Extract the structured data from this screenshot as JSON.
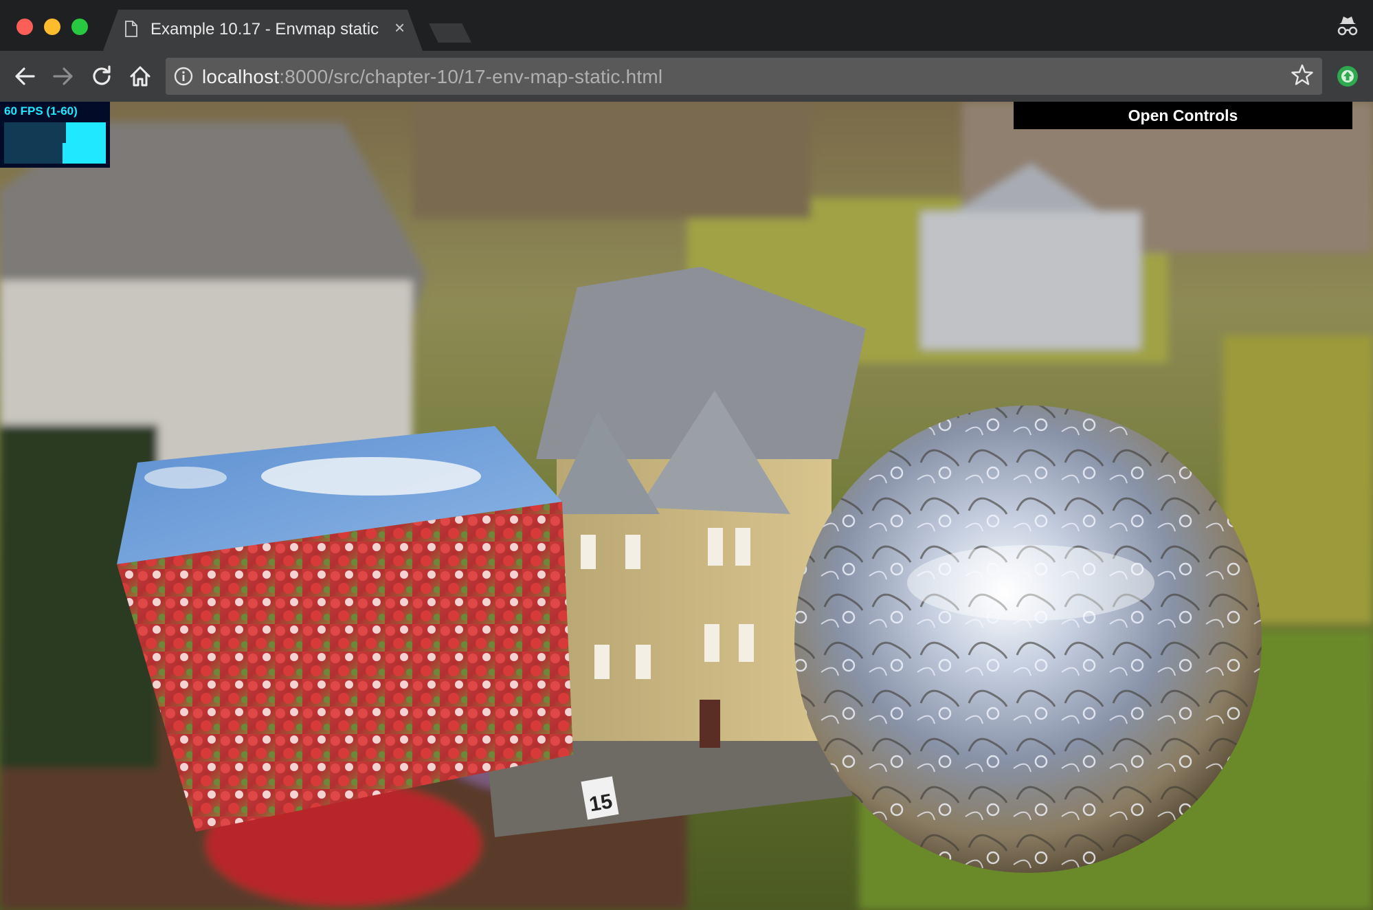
{
  "window": {
    "tab_title": "Example 10.17 - Envmap static",
    "tab_close_glyph": "×",
    "icons": [
      "window-close-icon",
      "window-minimize-icon",
      "window-maximize-icon",
      "page-icon",
      "incognito-icon"
    ]
  },
  "toolbar": {
    "url_host": "localhost",
    "url_rest": ":8000/src/chapter-10/17-env-map-static.html",
    "icons": [
      "back-arrow-icon",
      "forward-arrow-icon",
      "reload-icon",
      "home-icon",
      "info-icon",
      "star-icon",
      "extension-icon"
    ]
  },
  "page": {
    "stats_label": "60 FPS (1-60)",
    "stats_fps_history": [
      0,
      0,
      0,
      0,
      0,
      0,
      0,
      0,
      0,
      0,
      0,
      0,
      0,
      0,
      0,
      0,
      0,
      0,
      0,
      0,
      0,
      0,
      0,
      0,
      0,
      0,
      0,
      0,
      0,
      0,
      0,
      0,
      0,
      0,
      0,
      0,
      0,
      0,
      0,
      0,
      0,
      0,
      0,
      0,
      0,
      0,
      0,
      0,
      0,
      0,
      0,
      0,
      0,
      0,
      0,
      0,
      0,
      0,
      0,
      0,
      0,
      0,
      0,
      0,
      0,
      0,
      0,
      0,
      0,
      0,
      0,
      0,
      0,
      0,
      0,
      0,
      0,
      0,
      0,
      0,
      0,
      0,
      0,
      0,
      0,
      0,
      0,
      0,
      0,
      0,
      0.5,
      0.5,
      0.5,
      0.5,
      0.5,
      0.5,
      1,
      1,
      1,
      1,
      1,
      1,
      1,
      1,
      1,
      1,
      1,
      1,
      1,
      1,
      1,
      1,
      1,
      1,
      1,
      1,
      1,
      1,
      1,
      1,
      1,
      1,
      1,
      1,
      1,
      1,
      1,
      1,
      1,
      1,
      1,
      1,
      1,
      1,
      1,
      1,
      1,
      1,
      1,
      1,
      1,
      1,
      1,
      1,
      1,
      1,
      1,
      1,
      1,
      1,
      1,
      1,
      1,
      1,
      1,
      1,
      1
    ],
    "controls_label": "Open Controls",
    "plate_number": "15"
  },
  "colors": {
    "stats_fg": "#20e8ff",
    "stats_bg": "#020b28",
    "traffic_close": "#fc5f57",
    "traffic_min": "#fdbc2e",
    "traffic_max": "#28c840"
  }
}
